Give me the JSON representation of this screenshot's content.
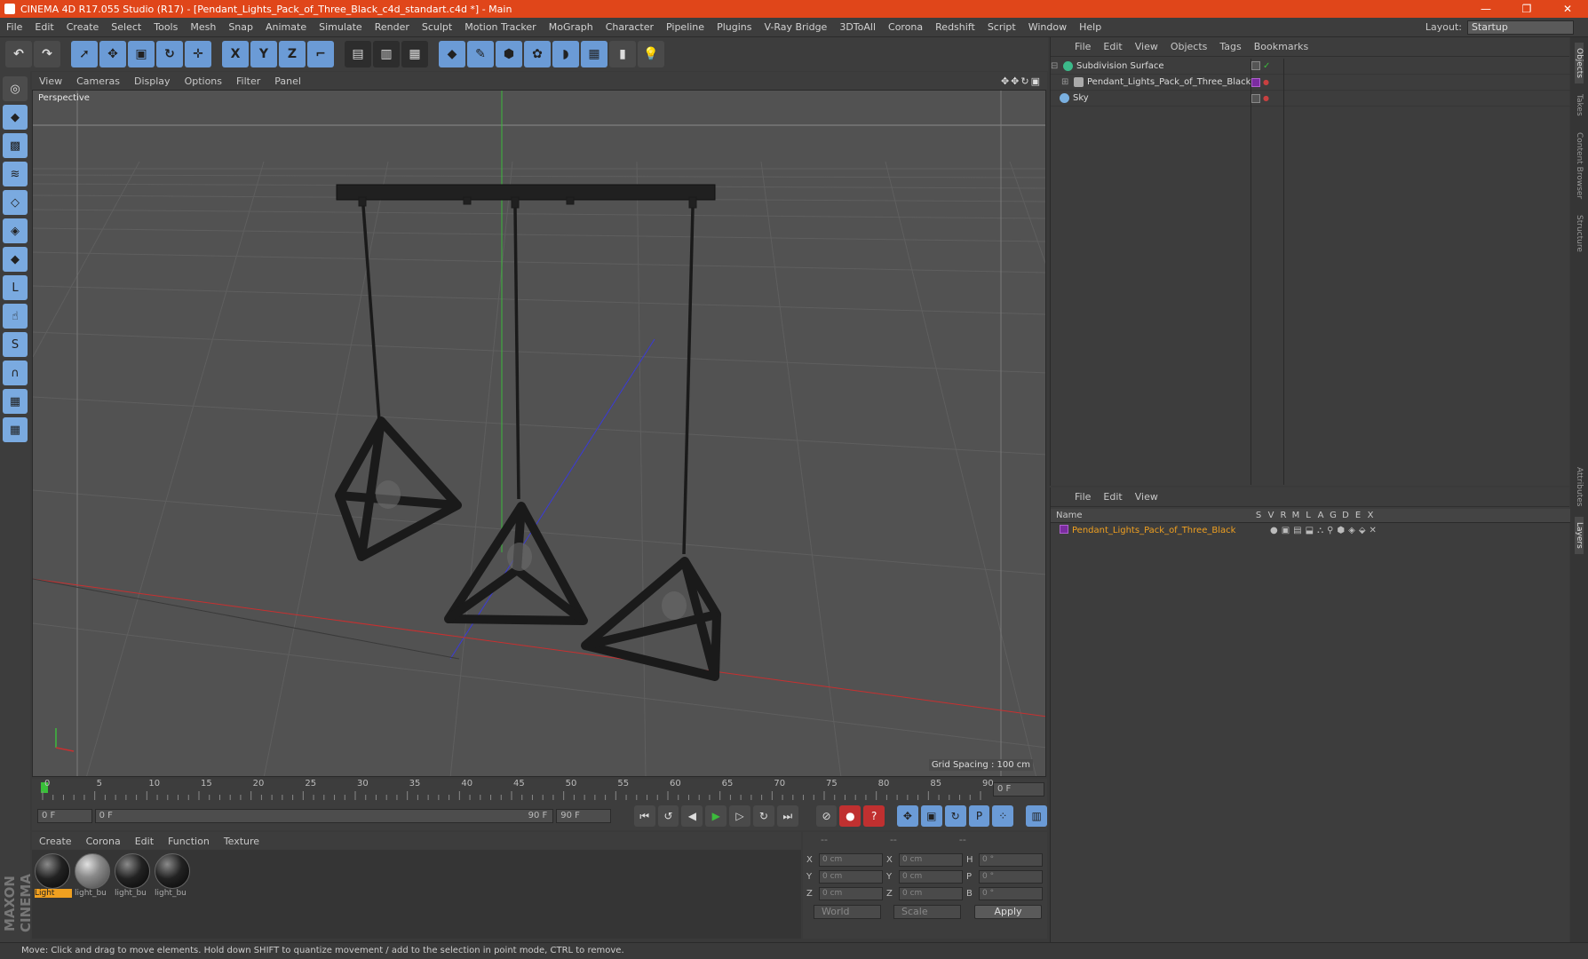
{
  "titlebar": {
    "title": "CINEMA 4D R17.055 Studio (R17) - [Pendant_Lights_Pack_of_Three_Black_c4d_standart.c4d *] - Main",
    "minimize": "—",
    "restore": "❐",
    "close": "✕"
  },
  "menu": [
    "File",
    "Edit",
    "Create",
    "Select",
    "Tools",
    "Mesh",
    "Snap",
    "Animate",
    "Simulate",
    "Render",
    "Sculpt",
    "Motion Tracker",
    "MoGraph",
    "Character",
    "Pipeline",
    "Plugins",
    "V-Ray Bridge",
    "3DToAll",
    "Corona",
    "Redshift",
    "Script",
    "Window",
    "Help"
  ],
  "layout": {
    "label": "Layout:",
    "value": "Startup"
  },
  "toolbar": {
    "x": "X",
    "y": "Y",
    "z": "Z"
  },
  "viewport": {
    "menu": [
      "View",
      "Cameras",
      "Display",
      "Options",
      "Filter",
      "Panel"
    ],
    "label": "Perspective",
    "grid_spacing": "Grid Spacing : 100 cm"
  },
  "timeline": {
    "ticks": [
      "0",
      "5",
      "10",
      "15",
      "20",
      "25",
      "30",
      "35",
      "40",
      "45",
      "50",
      "55",
      "60",
      "65",
      "70",
      "75",
      "80",
      "85",
      "90"
    ],
    "current_frame": "0 F",
    "start_field": "0 F",
    "range_start": "0 F",
    "range_end": "90 F",
    "end_field": "90 F"
  },
  "materials": {
    "menu": [
      "Create",
      "Corona",
      "Edit",
      "Function",
      "Texture"
    ],
    "items": [
      {
        "name": "Light"
      },
      {
        "name": "light_bu"
      },
      {
        "name": "light_bu"
      },
      {
        "name": "light_bu"
      }
    ]
  },
  "coords": {
    "header": [
      "--",
      "--",
      "--"
    ],
    "rows": [
      {
        "a": "X",
        "av": "0 cm",
        "b": "X",
        "bv": "0 cm",
        "c": "H",
        "cv": "0 °"
      },
      {
        "a": "Y",
        "av": "0 cm",
        "b": "Y",
        "bv": "0 cm",
        "c": "P",
        "cv": "0 °"
      },
      {
        "a": "Z",
        "av": "0 cm",
        "b": "Z",
        "bv": "0 cm",
        "c": "B",
        "cv": "0 °"
      }
    ],
    "world": "World",
    "scale": "Scale",
    "apply": "Apply"
  },
  "objects": {
    "menu": [
      "File",
      "Edit",
      "View",
      "Objects",
      "Tags",
      "Bookmarks"
    ],
    "items": [
      {
        "name": "Subdivision Surface"
      },
      {
        "name": "Pendant_Lights_Pack_of_Three_Black"
      },
      {
        "name": "Sky"
      }
    ]
  },
  "layers": {
    "menu": [
      "File",
      "Edit",
      "View"
    ],
    "name_header": "Name",
    "cols": [
      "S",
      "V",
      "R",
      "M",
      "L",
      "A",
      "G",
      "D",
      "E",
      "X"
    ],
    "row_name": "Pendant_Lights_Pack_of_Three_Black"
  },
  "sidetabs": [
    "Objects",
    "Takes",
    "Content Browser",
    "Structure",
    "Attributes",
    "Layers"
  ],
  "brand": "MAXON CINEMA 4D",
  "status": "Move: Click and drag to move elements. Hold down SHIFT to quantize movement / add to the selection in point mode, CTRL to remove."
}
